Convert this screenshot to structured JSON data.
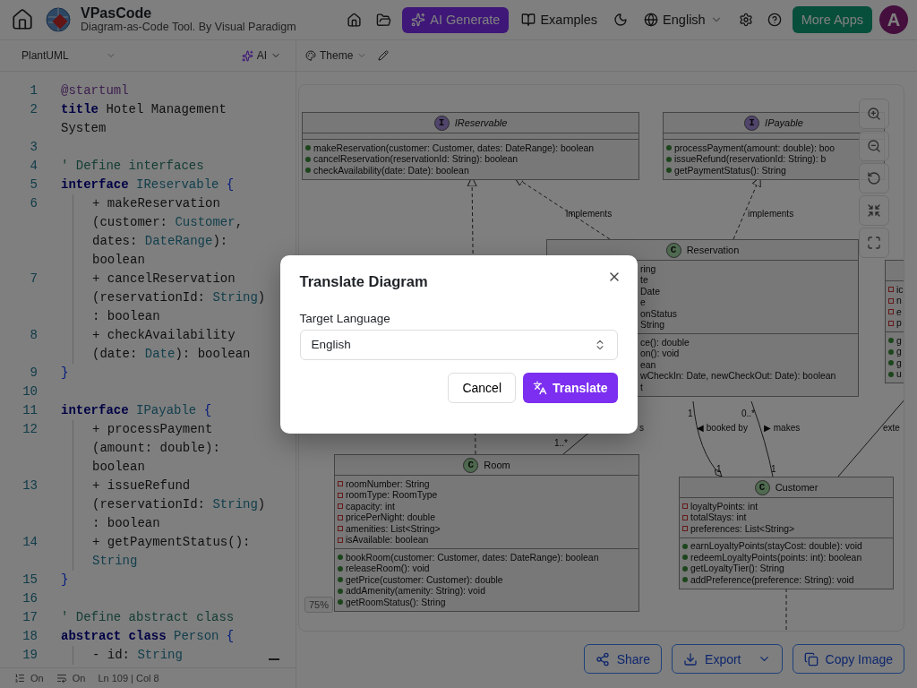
{
  "header": {
    "title": "VPasCode",
    "subtitle": "Diagram-as-Code Tool. By Visual Paradigm",
    "ai_button": "AI Generate",
    "examples": "Examples",
    "language": "English",
    "more_apps": "More Apps",
    "avatar": "A"
  },
  "editor_toolbar": {
    "language": "PlantUML",
    "ai": "AI"
  },
  "canvas_toolbar": {
    "theme": "Theme"
  },
  "editor": {
    "lines": [
      {
        "number": "1",
        "indented": false,
        "wrapped": [
          {
            "segments": [
              {
                "text": "@startuml",
                "kind": "directive"
              }
            ]
          }
        ]
      },
      {
        "number": "2",
        "indented": false,
        "wrapped": [
          {
            "segments": [
              {
                "text": "title",
                "kind": "keyword"
              },
              {
                "text": " Hotel Management",
                "kind": "plain"
              }
            ]
          },
          {
            "segments": [
              {
                "text": "System",
                "kind": "plain"
              }
            ]
          }
        ]
      },
      {
        "number": "3",
        "indented": false
      },
      {
        "number": "4",
        "indented": false,
        "wrapped": [
          {
            "segments": [
              {
                "text": "' Define interfaces",
                "kind": "comment"
              }
            ]
          }
        ]
      },
      {
        "number": "5",
        "indented": false,
        "wrapped": [
          {
            "segments": [
              {
                "text": "interface",
                "kind": "keyword"
              },
              {
                "text": " IReservable",
                "kind": "type"
              },
              {
                "text": " {",
                "kind": "brace"
              }
            ]
          }
        ]
      },
      {
        "number": "6",
        "indented": true,
        "wrapped": [
          {
            "segments": [
              {
                "text": "+ makeReservation",
                "kind": "plain"
              }
            ]
          },
          {
            "segments": [
              {
                "text": "(customer: ",
                "kind": "plain"
              },
              {
                "text": "Customer",
                "kind": "type"
              },
              {
                "text": ",",
                "kind": "plain"
              }
            ]
          },
          {
            "segments": [
              {
                "text": "dates: ",
                "kind": "plain"
              },
              {
                "text": "DateRange",
                "kind": "type"
              },
              {
                "text": "):",
                "kind": "plain"
              }
            ]
          },
          {
            "segments": [
              {
                "text": "boolean",
                "kind": "plain"
              }
            ]
          }
        ]
      },
      {
        "number": "7",
        "indented": true,
        "wrapped": [
          {
            "segments": [
              {
                "text": "+ cancelReservation",
                "kind": "plain"
              }
            ]
          },
          {
            "segments": [
              {
                "text": "(reservationId: ",
                "kind": "plain"
              },
              {
                "text": "String",
                "kind": "type"
              },
              {
                "text": ")",
                "kind": "plain"
              }
            ]
          },
          {
            "segments": [
              {
                "text": ": boolean",
                "kind": "plain"
              }
            ]
          }
        ]
      },
      {
        "number": "8",
        "indented": true,
        "wrapped": [
          {
            "segments": [
              {
                "text": "+ checkAvailability",
                "kind": "plain"
              }
            ]
          },
          {
            "segments": [
              {
                "text": "(date: ",
                "kind": "plain"
              },
              {
                "text": "Date",
                "kind": "type"
              },
              {
                "text": "): boolean",
                "kind": "plain"
              }
            ]
          }
        ]
      },
      {
        "number": "9",
        "indented": false,
        "wrapped": [
          {
            "segments": [
              {
                "text": "}",
                "kind": "brace"
              }
            ]
          }
        ]
      },
      {
        "number": "10",
        "indented": false
      },
      {
        "number": "11",
        "indented": false,
        "wrapped": [
          {
            "segments": [
              {
                "text": "interface",
                "kind": "keyword"
              },
              {
                "text": " IPayable",
                "kind": "type"
              },
              {
                "text": " {",
                "kind": "brace"
              }
            ]
          }
        ]
      },
      {
        "number": "12",
        "indented": true,
        "wrapped": [
          {
            "segments": [
              {
                "text": "+ processPayment",
                "kind": "plain"
              }
            ]
          },
          {
            "segments": [
              {
                "text": "(amount: double):",
                "kind": "plain"
              }
            ]
          },
          {
            "segments": [
              {
                "text": "boolean",
                "kind": "plain"
              }
            ]
          }
        ]
      },
      {
        "number": "13",
        "indented": true,
        "wrapped": [
          {
            "segments": [
              {
                "text": "+ issueRefund",
                "kind": "plain"
              }
            ]
          },
          {
            "segments": [
              {
                "text": "(reservationId: ",
                "kind": "plain"
              },
              {
                "text": "String",
                "kind": "type"
              },
              {
                "text": ")",
                "kind": "plain"
              }
            ]
          },
          {
            "segments": [
              {
                "text": ": boolean",
                "kind": "plain"
              }
            ]
          }
        ]
      },
      {
        "number": "14",
        "indented": true,
        "wrapped": [
          {
            "segments": [
              {
                "text": "+ getPaymentStatus():",
                "kind": "plain"
              }
            ]
          },
          {
            "segments": [
              {
                "text": "String",
                "kind": "type"
              }
            ]
          }
        ]
      },
      {
        "number": "15",
        "indented": false,
        "wrapped": [
          {
            "segments": [
              {
                "text": "}",
                "kind": "brace"
              }
            ]
          }
        ]
      },
      {
        "number": "16",
        "indented": false
      },
      {
        "number": "17",
        "indented": false,
        "wrapped": [
          {
            "segments": [
              {
                "text": "' Define abstract class",
                "kind": "comment"
              }
            ]
          }
        ]
      },
      {
        "number": "18",
        "indented": false,
        "wrapped": [
          {
            "segments": [
              {
                "text": "abstract class",
                "kind": "keyword"
              },
              {
                "text": " Person",
                "kind": "type"
              },
              {
                "text": " {",
                "kind": "brace"
              }
            ]
          }
        ]
      },
      {
        "number": "19",
        "indented": true,
        "wrapped": [
          {
            "segments": [
              {
                "text": "- id: ",
                "kind": "plain"
              },
              {
                "text": "String",
                "kind": "type"
              }
            ]
          }
        ]
      }
    ]
  },
  "status_bar": {
    "line_numbers": "On",
    "word_wrap": "On",
    "position": "Ln 109 | Col 8"
  },
  "diagram": {
    "classes": [
      {
        "kind": "interface",
        "badge": "I",
        "name": "IReservable",
        "methods": [
          "makeReservation(customer: Customer, dates: DateRange): boolean",
          "cancelReservation(reservationId: String): boolean",
          "checkAvailability(date: Date): boolean"
        ]
      },
      {
        "kind": "interface",
        "badge": "I",
        "name": "IPayable",
        "methods": [
          "processPayment(amount: double): boo",
          "issueRefund(reservationId: String): b",
          "getPaymentStatus(): String"
        ]
      },
      {
        "kind": "class",
        "badge": "C",
        "name": "Reservation",
        "attributes": [
          "ring",
          "te",
          "Date",
          "e",
          "onStatus",
          "String"
        ],
        "methods": [
          "ce(): double",
          "on(): void",
          "ean",
          "wCheckIn: Date, newCheckOut: Date): boolean",
          "t"
        ]
      },
      {
        "kind": "partial",
        "attributes": [
          "ic",
          "n",
          "e",
          "p"
        ],
        "methods": [
          "g",
          "g",
          "g",
          "u"
        ]
      },
      {
        "kind": "class",
        "badge": "C",
        "name": "Room",
        "attributes": [
          "roomNumber: String",
          "roomType: RoomType",
          "capacity: int",
          "pricePerNight: double",
          "amenities: List<String>",
          "isAvailable: boolean"
        ],
        "methods": [
          "bookRoom(customer: Customer, dates: DateRange): boolean",
          "releaseRoom(): void",
          "getPrice(customer: Customer): double",
          "addAmenity(amenity: String): void",
          "getRoomStatus(): String"
        ]
      },
      {
        "kind": "class",
        "badge": "C",
        "name": "Customer",
        "attributes": [
          "loyaltyPoints: int",
          "totalStays: int",
          "preferences: List<String>"
        ],
        "methods": [
          "earnLoyaltyPoints(stayCost: double): void",
          "redeemLoyaltyPoints(points: int): boolean",
          "getLoyaltyTier(): String",
          "addPreference(preference: String): void"
        ]
      }
    ],
    "labels": [
      "implements",
      "implements",
      "1",
      "0..*",
      "s",
      "◀ booked by",
      "▶ makes",
      "exte",
      "1..*",
      "1",
      "1"
    ]
  },
  "zoom": "75%",
  "actions": [
    {
      "kind": "share",
      "label": "Share"
    },
    {
      "kind": "export",
      "label": "Export"
    },
    {
      "kind": "copy",
      "label": "Copy Image"
    }
  ],
  "dialog": {
    "title": "Translate Diagram",
    "field_label": "Target Language",
    "value": "English",
    "cancel": "Cancel",
    "confirm": "Translate"
  }
}
